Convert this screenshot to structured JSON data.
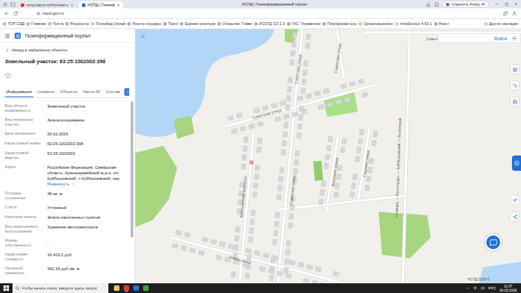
{
  "browser": {
    "tabs": [
      {
        "label": "нспд карта публичная к",
        "selected": false
      },
      {
        "label": "НСПД | Геоинф",
        "selected": true
      }
    ],
    "title": "НСПД | Геоинформационный портал",
    "assistant": "Спросить Алису AI",
    "address": "nspd.gov.ru",
    "bookmarks": [
      "ТОР СЭД",
      "Главная",
      "Почта",
      "Росреестр",
      "ТехноКад Онлай",
      "Реестр государс",
      "Торги",
      "Единая электрон",
      "Открытая. Главн",
      "ИСОГД СО 2.0",
      "ГАС \"Управлени",
      "Платформа госу",
      "Организационно",
      "IntraService 4.53.1",
      "Реест",
      "Другие закладки"
    ]
  },
  "app": {
    "title": "Геоинформационный портал",
    "login": "Войти"
  },
  "panel": {
    "back": "Назад в найденные объекты",
    "title": "Земельный участок: 63:25:1002003:398",
    "starred": false,
    "tabs": [
      {
        "label": "Информация",
        "selected": true
      },
      {
        "label": "Сервисы",
        "selected": false
      },
      {
        "label": "Объекты",
        "selected": false
      },
      {
        "label": "Части ЗУ",
        "selected": false
      },
      {
        "label": "Состав",
        "selected": false
      }
    ],
    "fields": [
      {
        "label": "Вид объекта недвижимости",
        "value": "Земельный участок"
      },
      {
        "label": "Вид земельного участка",
        "value": "Землепользование"
      },
      {
        "label": "Дата присвоения",
        "value": "26.02.2026"
      },
      {
        "label": "Кадастровый номер",
        "value": "63:25:1002003:398"
      },
      {
        "label": "Кадастровый квартал",
        "value": "63:25:1002003"
      },
      {
        "label": "Адрес",
        "value": "Российская Федерация, Самарская область, Красноармейский м.р-н, с/п Куйбышевский, п Куйбышевский, пер",
        "expand": "Развернуть"
      },
      {
        "label": "Площадь уточненная",
        "value": "48 кв. м"
      },
      {
        "label": "Статус",
        "value": "Учтенный"
      },
      {
        "label": "Категория земель",
        "value": "Земли населенных пунктов"
      },
      {
        "label": "Вид разрешенного использования",
        "value": "Хранение автотранспорта"
      },
      {
        "label": "Форма собственности",
        "value": "-"
      },
      {
        "label": "Кадастровая стоимость",
        "value": "16 423,2 руб."
      },
      {
        "label": "Удельный показатель",
        "value": "342,15 руб./кв. м"
      }
    ]
  },
  "map": {
    "labels": [
      "Советская улица",
      "Советская улица",
      "Советская улица",
      "Советская улица",
      "Советская улица",
      "Весенняя улица",
      "Садовая улица",
      "Крестьянский переулок",
      "Новая улица",
      "«Самара — Волгоград» — Куйбышевский — Встречный"
    ],
    "watermark": "НСПД 2026 ©"
  },
  "taskbar": {
    "search": "Чтобы начать поиск, введите здесь запрос",
    "language": "РУС",
    "time": "11:07",
    "date": "30.03.2026"
  }
}
